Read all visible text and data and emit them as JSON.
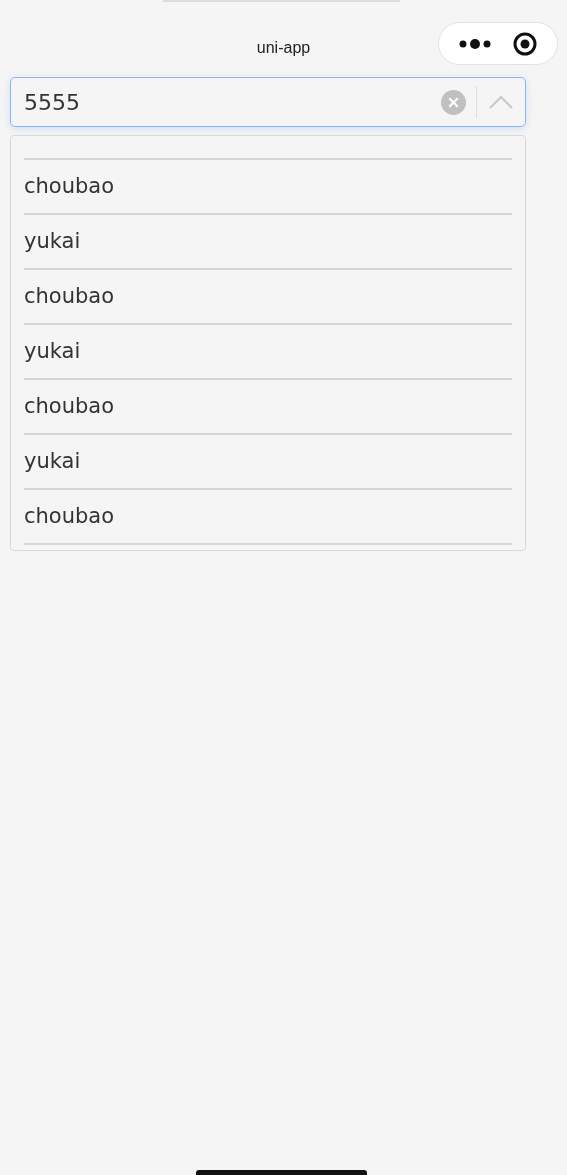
{
  "nav_bar": {
    "title": "uni-app"
  },
  "combobox": {
    "value": "5555",
    "expanded": true
  },
  "options": [
    {
      "label": "choubao"
    },
    {
      "label": "yukai"
    },
    {
      "label": "choubao"
    },
    {
      "label": "yukai"
    },
    {
      "label": "choubao"
    },
    {
      "label": "yukai"
    },
    {
      "label": "choubao"
    }
  ]
}
